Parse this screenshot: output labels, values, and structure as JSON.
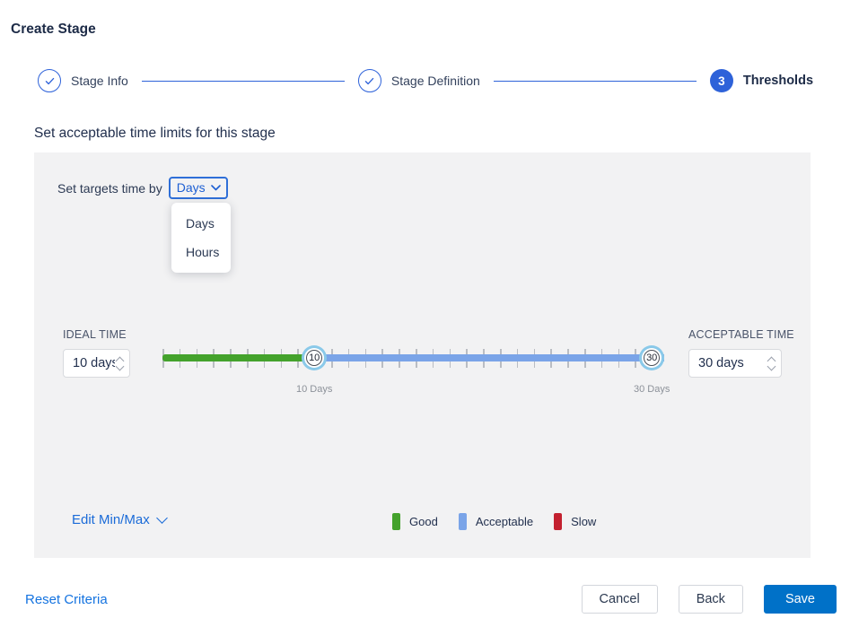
{
  "window": {
    "title": "Create Stage"
  },
  "stepper": {
    "steps": [
      {
        "label": "Stage Info",
        "state": "complete"
      },
      {
        "label": "Stage Definition",
        "state": "complete"
      },
      {
        "label": "Thresholds",
        "state": "current",
        "number": "3"
      }
    ]
  },
  "content": {
    "heading": "Set acceptable time limits for this stage",
    "targets": {
      "label": "Set targets time by",
      "selected": "Days",
      "options": [
        "Days",
        "Hours"
      ]
    },
    "ideal": {
      "label": "IDEAL TIME",
      "value": "10 days"
    },
    "acceptable": {
      "label": "ACCEPTABLE TIME",
      "value": "30 days"
    },
    "slider": {
      "min_days": 1,
      "max_days": 31,
      "ideal_days": 10,
      "acceptable_days": 30,
      "ideal_handle": "10",
      "acceptable_handle": "30",
      "ideal_caption": "10 Days",
      "acceptable_caption": "30 Days"
    },
    "edit_minmax_label": "Edit Min/Max",
    "legend": [
      {
        "label": "Good",
        "color": "#44A22C"
      },
      {
        "label": "Acceptable",
        "color": "#7AA4E8"
      },
      {
        "label": "Slow",
        "color": "#C3202F"
      }
    ]
  },
  "footer": {
    "reset": "Reset Criteria",
    "cancel": "Cancel",
    "back": "Back",
    "save": "Save"
  },
  "colors": {
    "accent_blue": "#2E62D9",
    "link_blue": "#1473E0",
    "save_blue": "#0071C8",
    "good_green": "#44A22C",
    "acceptable_blue": "#7AA4E8",
    "slow_red": "#C3202F",
    "handle_ring": "#8AC9E9"
  }
}
